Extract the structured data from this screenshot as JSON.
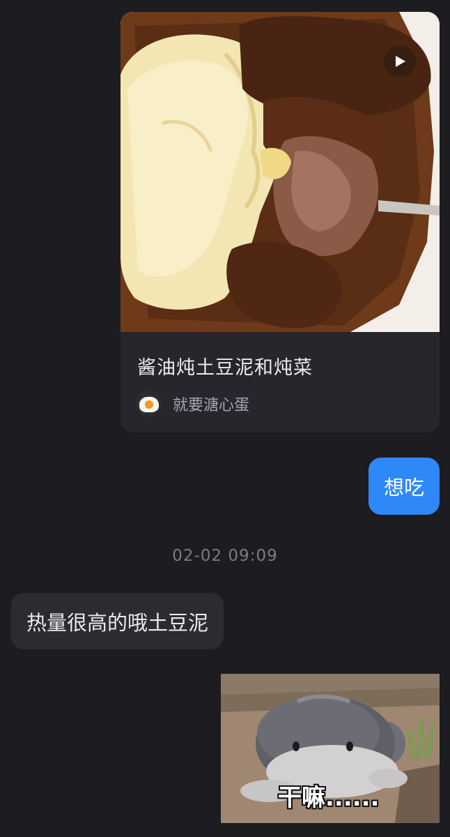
{
  "shared_card": {
    "title": "酱油炖土豆泥和炖菜",
    "author": "就要溏心蛋",
    "media_icon": "play-icon",
    "author_avatar": "fried-egg-avatar"
  },
  "messages": {
    "outgoing_1": "想吃",
    "timestamp": "02-02 09:09",
    "incoming_1": "热量很高的哦土豆泥"
  },
  "sticker": {
    "caption": "干嘛......",
    "subject": "gray-blob-creature-sticker"
  },
  "colors": {
    "background": "#1c1c21",
    "card": "#26262d",
    "bubble_out": "#2f88f7",
    "bubble_in": "#2b2b31",
    "timestamp": "#7b7b84"
  }
}
